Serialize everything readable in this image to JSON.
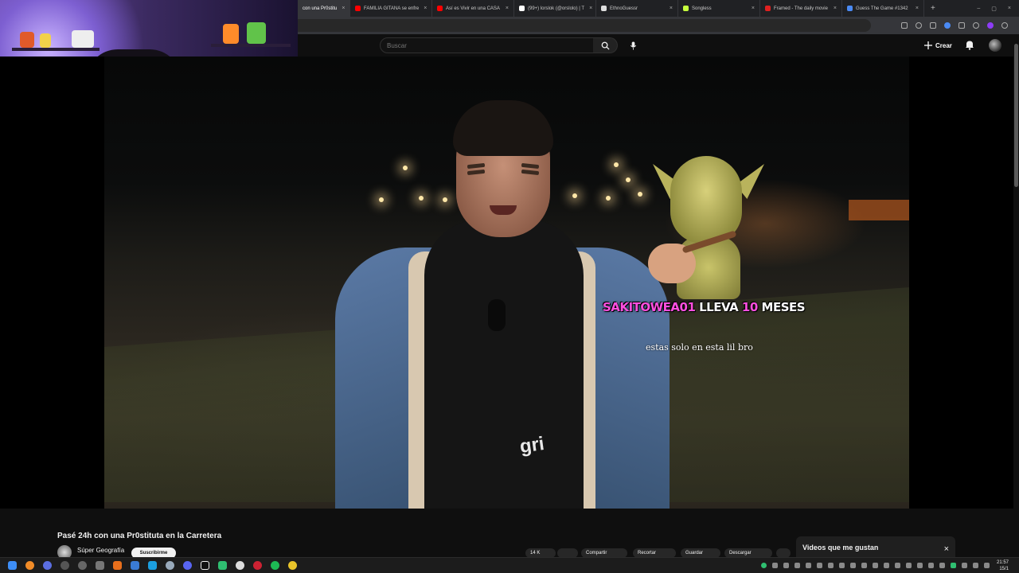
{
  "browser": {
    "tabs": [
      {
        "label": "con una Pr0stitu",
        "favicon_color": "#ff0000",
        "active": true
      },
      {
        "label": "FAMILIA GITANA se enfre",
        "favicon_color": "#ff0000",
        "active": false
      },
      {
        "label": "Así es Vivir en una CASA",
        "favicon_color": "#ff0000",
        "active": false
      },
      {
        "label": "(99+) lorslok (@orslolo) | T",
        "favicon_color": "#ffffff",
        "active": false
      },
      {
        "label": "EthnoGuessr",
        "favicon_color": "#dddddd",
        "active": false
      },
      {
        "label": "Songless",
        "favicon_color": "#c6ff3d",
        "active": false
      },
      {
        "label": "Framed - The daily movie",
        "favicon_color": "#e02020",
        "active": false
      },
      {
        "label": "Guess The Game #1342",
        "favicon_color": "#4a8af4",
        "active": false
      }
    ],
    "close_glyph": "×",
    "new_tab_glyph": "+",
    "window_controls": [
      "–",
      "▢",
      "×"
    ]
  },
  "youtube": {
    "search_placeholder": "Buscar",
    "create_label": "Crear",
    "search_icon": "search-icon",
    "mic_icon": "mic-icon",
    "bell_icon": "bell-icon"
  },
  "video": {
    "overlay": {
      "username": "SAKITOWEA01",
      "lleva": "LLEVA",
      "months_number": "10",
      "months_word": "MESES",
      "message": "estas solo en esta lil bro"
    },
    "shirt_text": "gri",
    "title": "Pasé 24h con una Pr0stituta en la Carretera",
    "channel_name": "Súper Geografía",
    "subscribe_label": "Suscribirme",
    "actions": [
      "14 K",
      "",
      "Compartir",
      "Recortar",
      "Guardar",
      "Descargar"
    ]
  },
  "side_panel": {
    "title": "Videos que me gustan",
    "close_glyph": "×"
  },
  "taskbar": {
    "time": "21:57",
    "date": "15/1"
  },
  "colors": {
    "youtube_bg": "#0f0f0f",
    "overlay_username": "#ff4fe0",
    "taskbar_bg": "#1c1c1c"
  }
}
